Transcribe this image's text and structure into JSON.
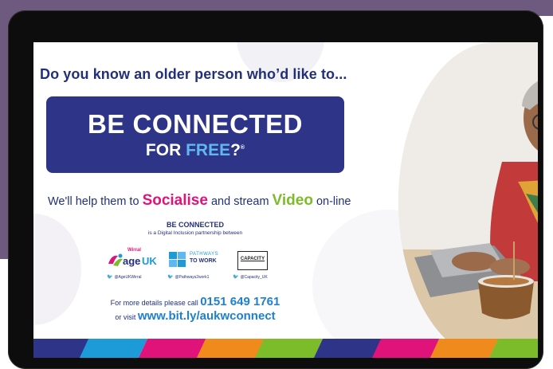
{
  "poster": {
    "headline": "Do you know an older person who’d like to...",
    "banner": {
      "line1": "BE CONNECTED",
      "for": "FOR ",
      "free": "FREE",
      "question": "?",
      "mark": "®"
    },
    "tagline": {
      "pre": "We'll help them to ",
      "socialise": "Socialise",
      "mid": " and stream ",
      "video": "Video",
      "post": " on-line"
    },
    "be_connected_title": "BE CONNECTED",
    "partnership_text": "is a Digital Inclusion partnership between",
    "partners": [
      {
        "logo_top": "Wirral",
        "logo_main": "age",
        "logo_suffix": "UK",
        "handle": "@AgeUKWirral"
      },
      {
        "logo_top": "PATHWAYS",
        "logo_main": "TO WORK",
        "handle": "@Pathways2work1"
      },
      {
        "logo_main": "CAPACITY",
        "handle": "@Capacity_UK"
      }
    ],
    "contact": {
      "prefix": "For more details please call ",
      "phone": "0151 649 1761",
      "visit_prefix": "or visit ",
      "url": "www.bit.ly/aukwconnect"
    }
  },
  "colors": {
    "navy": "#2e3488",
    "pink": "#e0137b",
    "green": "#7cbc2a",
    "light_blue": "#5fb8ef",
    "stripe": [
      "#2e3488",
      "#1d9bd8",
      "#e0137b",
      "#f08a1c",
      "#7cbc2a",
      "#2e3488",
      "#e0137b",
      "#f08a1c"
    ]
  },
  "icons": [
    "twitter-bird-icon",
    "pathways-puzzle-icon",
    "age-uk-logo-icon"
  ]
}
